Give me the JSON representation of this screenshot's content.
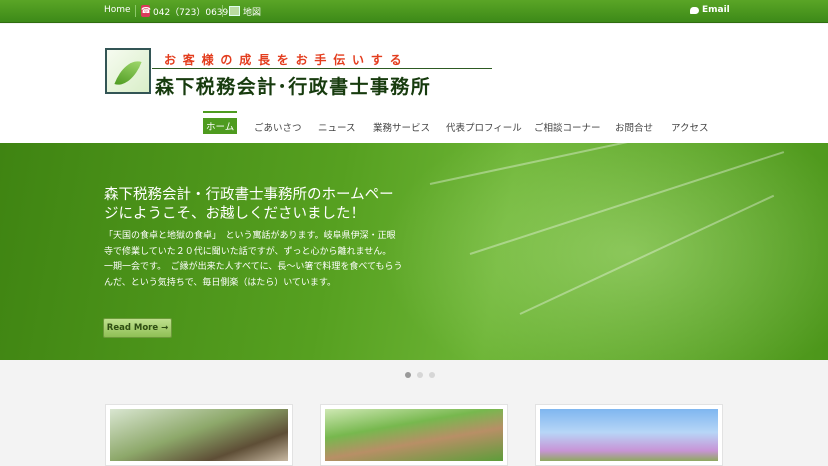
{
  "topbar": {
    "home": "Home",
    "phone": "042（723）0639",
    "map": "地図",
    "email": "Email"
  },
  "header": {
    "tagline": "お客様の成長をお手伝いする",
    "brand": "森下税務会計･行政書士事務所"
  },
  "nav": {
    "items": [
      "ホーム",
      "ごあいさつ",
      "ニュース",
      "業務サービス",
      "代表プロフィール",
      "ご相談コーナー",
      "お問合せ",
      "アクセス"
    ],
    "active_index": 0
  },
  "hero": {
    "title": "森下税務会計・行政書士事務所のホームページにようこそ、お越しくださいました！",
    "text": "「天国の食卓と地獄の食卓」　という寓話があります。岐阜県伊深・正眼寺で修業していた２０代に聞いた話ですが、ずっと心から離れません。　一期一会です。　ご縁が出来た人すべてに、長～い箸で料理を食べてもらうんだ、という気持ちで、毎日側楽（はたら）いています。",
    "button": "Read More →"
  },
  "slider": {
    "slides": 3,
    "current": 1
  },
  "colors": {
    "topbar": "#4a9a1f",
    "accent": "#4e9b1f",
    "tagline": "#e33d1e",
    "brand": "#173b0e"
  }
}
